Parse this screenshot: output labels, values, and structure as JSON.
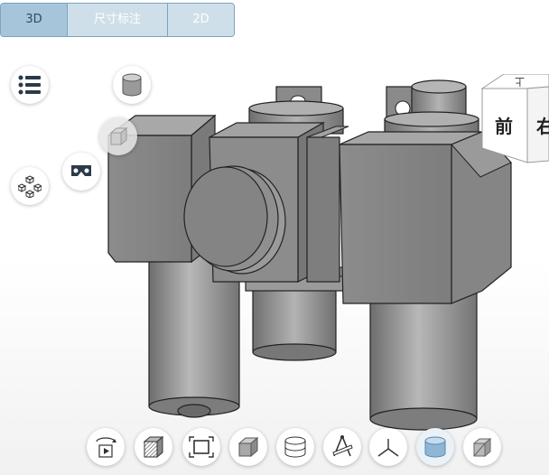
{
  "tabs": {
    "t3d": "3D",
    "dimension": "尺寸标注",
    "t2d": "2D"
  },
  "viewcube": {
    "front": "前",
    "top": "上",
    "right": "右"
  },
  "colors": {
    "tab_active": "#a7c5da",
    "tab_inactive": "#cfdfea",
    "tab_border": "#7aa4c0",
    "model_body": "#8a8a8a",
    "accent_blue": "#9ec3e0"
  },
  "icons": {
    "left": [
      "list-icon",
      "cylinder-icon",
      "cube-icon",
      "vr-headset-icon",
      "explode-icon"
    ],
    "toolbar": [
      "rotate-play-icon",
      "section-icon",
      "fit-view-icon",
      "solid-cube-icon",
      "wire-cylinder-icon",
      "measure-icon",
      "axis-icon",
      "material-icon",
      "display-mode-icon"
    ]
  }
}
